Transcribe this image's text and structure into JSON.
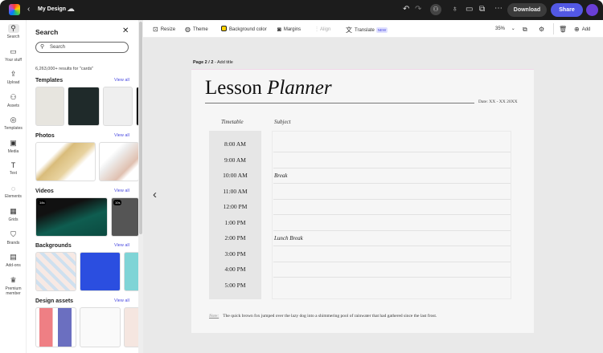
{
  "topbar": {
    "title": "My Design",
    "download": "Download",
    "share": "Share"
  },
  "rail": [
    {
      "label": "Search",
      "icon": "search-icon"
    },
    {
      "label": "Your stuff",
      "icon": "folder-icon"
    },
    {
      "label": "Upload",
      "icon": "upload-icon"
    },
    {
      "label": "Assets",
      "icon": "assets-icon"
    },
    {
      "label": "Templates",
      "icon": "templates-icon"
    },
    {
      "label": "Media",
      "icon": "media-icon"
    },
    {
      "label": "Text",
      "icon": "text-icon"
    },
    {
      "label": "Elements",
      "icon": "elements-icon"
    },
    {
      "label": "Grids",
      "icon": "grids-icon"
    },
    {
      "label": "Brands",
      "icon": "brands-icon"
    },
    {
      "label": "Add-ons",
      "icon": "addons-icon"
    },
    {
      "label": "Premium member",
      "icon": "crown-icon"
    }
  ],
  "panel": {
    "title": "Search",
    "search_placeholder": "Search",
    "results": "6,263,000+ results for \"cards\"",
    "view_all": "View all",
    "sections": [
      "Templates",
      "Photos",
      "Videos",
      "Backgrounds",
      "Design assets"
    ],
    "video_durations": [
      "14s",
      "10s"
    ]
  },
  "toolbar": {
    "resize": "Resize",
    "theme": "Theme",
    "background_color": "Background color",
    "margins": "Margins",
    "align": "Align",
    "translate": "Translate",
    "new_badge": "NEW",
    "zoom": "35%",
    "add": "Add"
  },
  "canvas": {
    "page_label": "Page 2 / 2",
    "add_title": " - Add title"
  },
  "page": {
    "title_regular": "Lesson ",
    "title_italic": "Planner",
    "date": "Date: XX - XX 20XX",
    "timetable_header": "Timetable",
    "subject_header": "Subject",
    "times": [
      "8:00 AM",
      "9:00 AM",
      "10:00 AM",
      "11:00 AM",
      "12:00 PM",
      "1:00 PM",
      "2:00 PM",
      "3:00 PM",
      "4:00 PM",
      "5:00 PM"
    ],
    "subjects": [
      "",
      "",
      "Break",
      "",
      "",
      "",
      "Lunch Break",
      "",
      "",
      ""
    ],
    "note_label": "Note:",
    "note": "The quick brown fox jumped over the lazy dog into a shimmering pool of rainwater that had gathered since the last frost."
  }
}
